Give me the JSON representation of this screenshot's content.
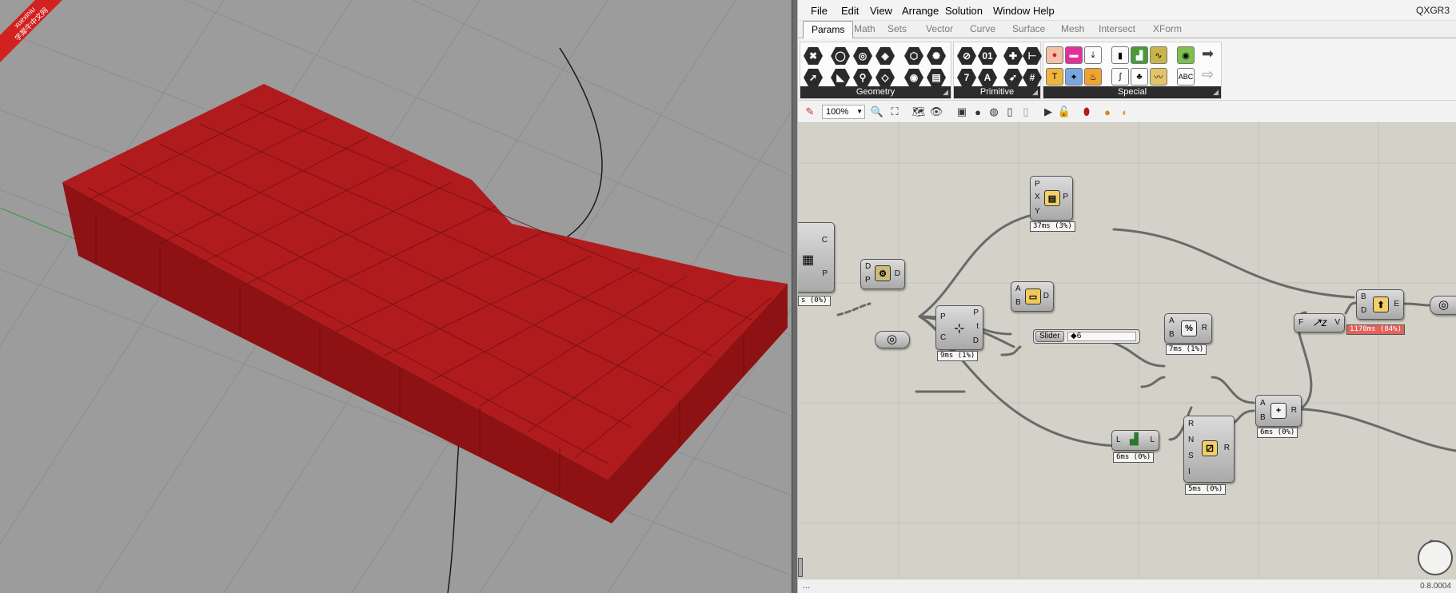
{
  "watermark": {
    "line1": "xuexiniu",
    "line2": "学犀牛中文网"
  },
  "colors": {
    "mesh": "#a8181a",
    "viewport": "#9c9c9c",
    "canvas": "#d4d2c8",
    "hot": "#e4625d"
  },
  "menu": {
    "items": [
      "File",
      "Edit",
      "View",
      "Arrange",
      "Solution",
      "Window",
      "Help"
    ],
    "document": "QXGR3"
  },
  "tabs": [
    "Params",
    "Math",
    "Sets",
    "Vector",
    "Curve",
    "Surface",
    "Mesh",
    "Intersect",
    "XForm"
  ],
  "ribbon": {
    "panels": [
      "Geometry",
      "Primitive",
      "Special"
    ],
    "glyphs": {
      "int": "01",
      "seven": "7",
      "a": "A",
      "abc": "ABC"
    }
  },
  "toolbar": {
    "zoom": "100%"
  },
  "components": {
    "left_param": {
      "out_c": "C",
      "out_p": "P",
      "time": "s (0%)"
    },
    "d_comp": {
      "in_d": "D",
      "in_p": "P",
      "out_d": "D"
    },
    "pxy": {
      "in_p": "P",
      "in_x": "X",
      "in_y": "Y",
      "out_p": "P",
      "time": "37ms (3%)"
    },
    "ab_d": {
      "in_a": "A",
      "in_b": "B",
      "out_d": "D"
    },
    "pc": {
      "in_p": "P",
      "in_c": "C",
      "out_p": "P",
      "out_t": "t",
      "out_d": "D",
      "time": "9ms (1%)"
    },
    "slider": {
      "label": "Slider",
      "value": "6"
    },
    "division": {
      "in_a": "A",
      "in_b": "B",
      "out_r": "R",
      "time": "7ms (1%)"
    },
    "addition": {
      "in_a": "A",
      "in_b": "B",
      "out_r": "R",
      "time": "6ms (0%)"
    },
    "bde": {
      "in_b": "B",
      "in_d": "D",
      "out_e": "E",
      "time": "1178ms (84%)"
    },
    "fv": {
      "in_f": "F",
      "out_v": "V"
    },
    "ll": {
      "in_l": "L",
      "out_l": "L",
      "time": "6ms (0%)"
    },
    "random": {
      "in_r": "R",
      "in_n": "N",
      "in_s": "S",
      "in_i": "I",
      "out_r": "R",
      "time": "5ms (0%)"
    }
  },
  "status": {
    "left": "...",
    "version": "0.8.0004"
  }
}
